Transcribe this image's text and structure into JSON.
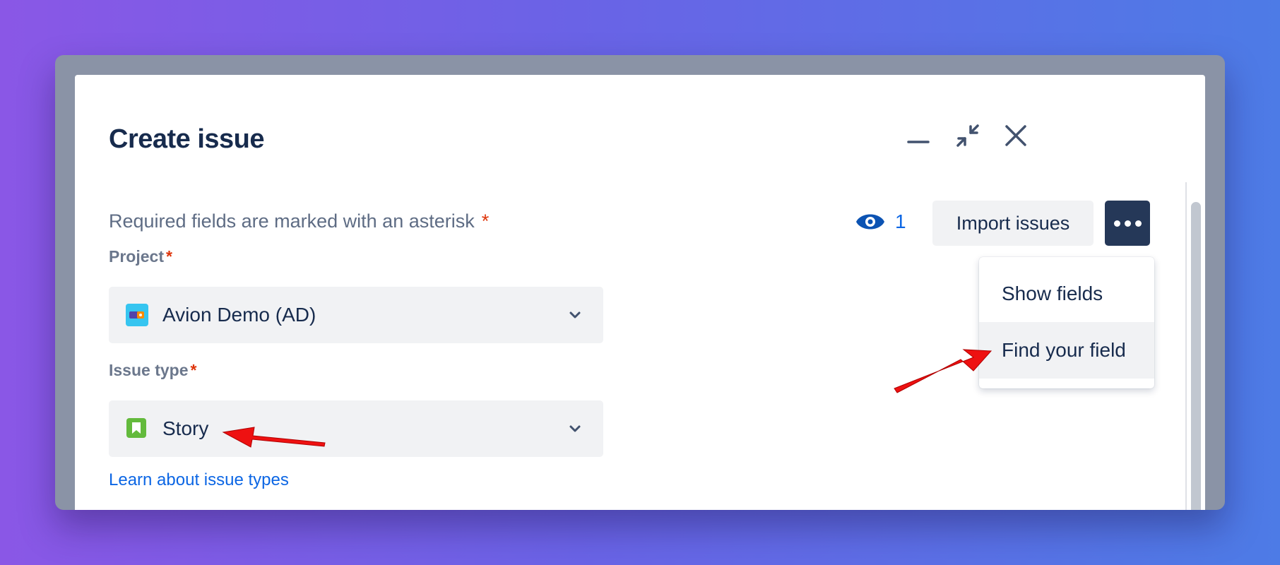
{
  "dialog": {
    "title": "Create issue",
    "header_actions": [
      "minimize-icon",
      "collapse-icon",
      "close-icon"
    ]
  },
  "required_note": {
    "text": "Required fields are marked with an asterisk",
    "asterisk": "*"
  },
  "watch": {
    "icon": "eye-icon",
    "count": "1"
  },
  "import_button": {
    "label": "Import issues"
  },
  "more_button": {
    "icon": "more-horizontal-icon"
  },
  "fields": {
    "project": {
      "label": "Project",
      "asterisk": "*",
      "value": "Avion Demo (AD)",
      "icon": "project-avatar-icon"
    },
    "issue_type": {
      "label": "Issue type",
      "asterisk": "*",
      "value": "Story",
      "icon": "story-icon"
    }
  },
  "learn_link": "Learn about issue types",
  "dropdown_menu": {
    "items": [
      "Show fields",
      "Find your field"
    ],
    "highlighted": "Find your field"
  },
  "annotations": [
    "red-arrow-to-story",
    "red-arrow-to-find-your-field"
  ],
  "colors": {
    "accent": "#0c66e4",
    "title": "#172b4d",
    "required": "#de350b",
    "more_button": "#253858"
  }
}
